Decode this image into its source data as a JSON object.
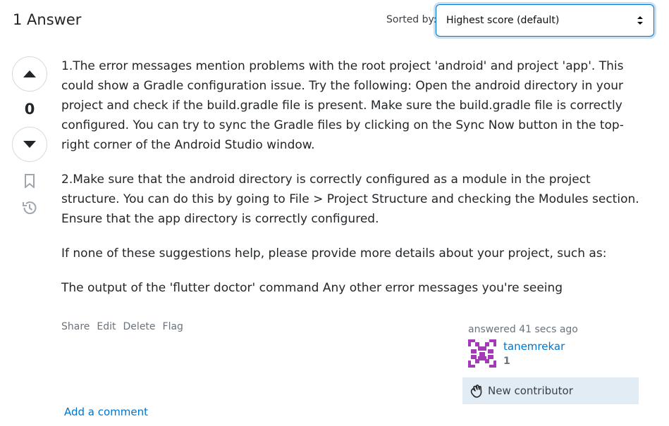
{
  "header": {
    "answer_count_label": "1 Answer",
    "sort_label": "Sorted by:",
    "sort_selected": "Highest score (default)"
  },
  "votes": {
    "score": "0"
  },
  "answer": {
    "paragraphs": [
      "1.The error messages mention problems with the root project 'android' and project 'app'. This could show a Gradle configuration issue. Try the following: Open the android directory in your project and check if the build.gradle file is present. Make sure the build.gradle file is correctly configured. You can try to sync the Gradle files by clicking on the Sync Now button in the top-right corner of the Android Studio window.",
      "2.Make sure that the android directory is correctly configured as a module in the project structure. You can do this by going to File > Project Structure and checking the Modules section. Ensure that the app directory is correctly configured.",
      "If none of these suggestions help, please provide more details about your project, such as:",
      "The output of the 'flutter doctor' command Any other error messages you're seeing"
    ]
  },
  "post_menu": {
    "share": "Share",
    "edit": "Edit",
    "delete": "Delete",
    "flag": "Flag"
  },
  "user_card": {
    "action_time": "answered 41 secs ago",
    "user_name": "tanemrekar",
    "reputation": "1",
    "new_contributor": "New contributor"
  },
  "comments": {
    "add_comment": "Add a comment"
  },
  "colors": {
    "link": "#0074cc",
    "avatar": "#a33bb6",
    "badge_bg": "#e1ecf4"
  }
}
